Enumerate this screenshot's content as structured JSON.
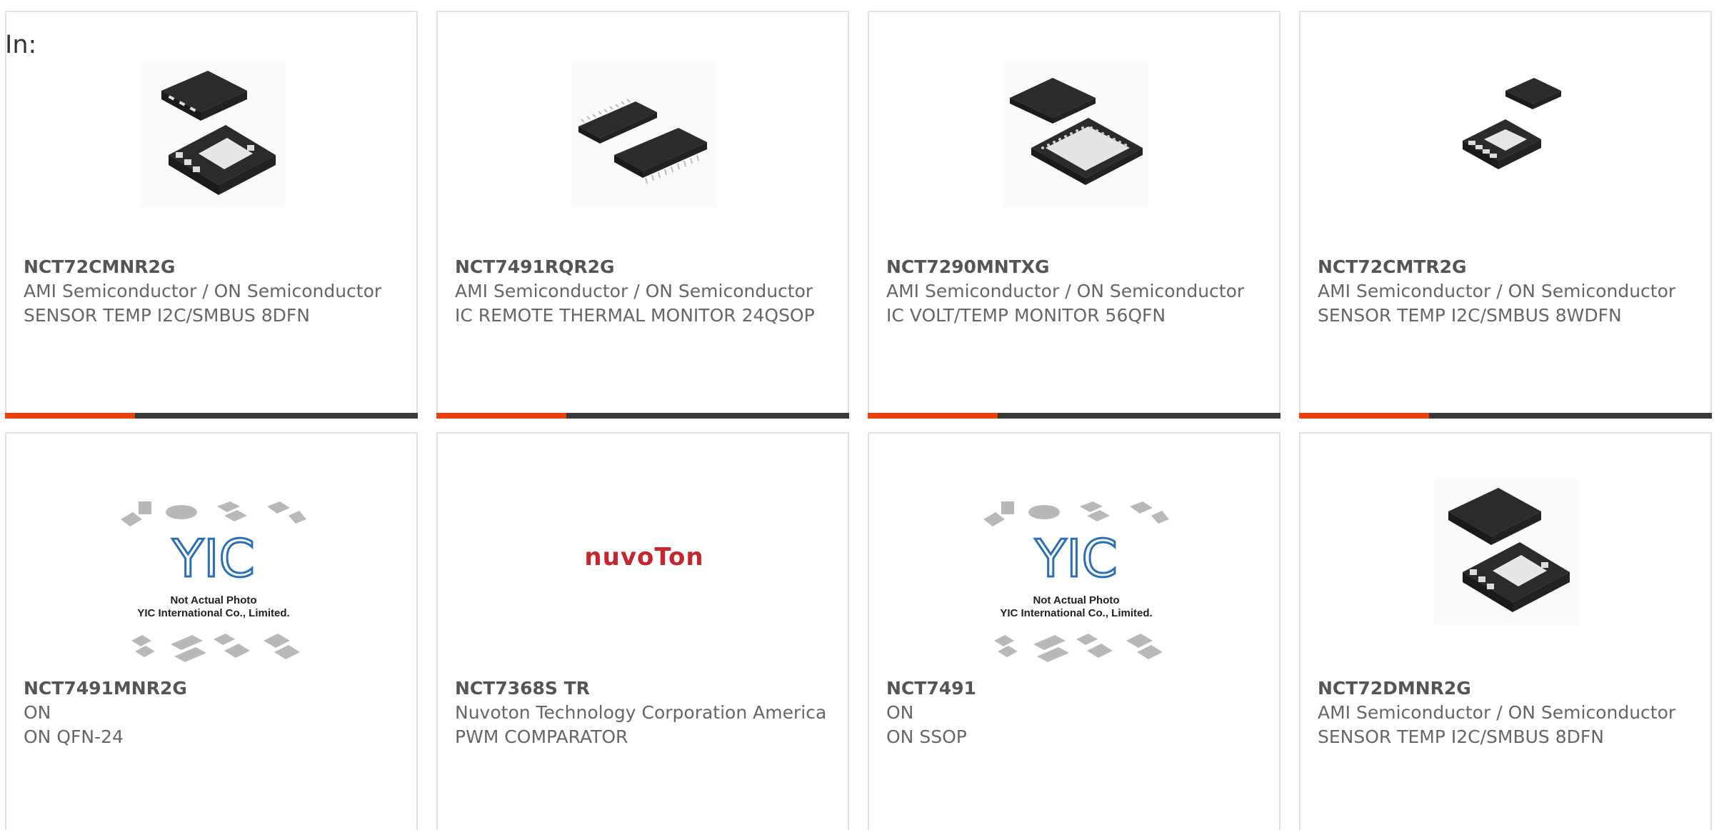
{
  "header": {
    "in_label": "In:"
  },
  "colors": {
    "accent": "#e8410f",
    "bar": "#3a3a3a",
    "card_border": "#e2e2e2",
    "text": "#666666",
    "nuvoton_red": "#c8262e",
    "yic_blue": "#2a6fb6"
  },
  "products": [
    {
      "part": "NCT72CMNR2G",
      "manufacturer": "AMI Semiconductor / ON Semiconductor",
      "description": "SENSOR TEMP I2C/SMBUS 8DFN",
      "image": "dfn-8-package-icon"
    },
    {
      "part": "NCT7491RQR2G",
      "manufacturer": "AMI Semiconductor / ON Semiconductor",
      "description": "IC REMOTE THERMAL MONITOR 24QSOP",
      "image": "qsop-24-package-icon"
    },
    {
      "part": "NCT7290MNTXG",
      "manufacturer": "AMI Semiconductor / ON Semiconductor",
      "description": "IC VOLT/TEMP MONITOR 56QFN",
      "image": "qfn-56-package-icon"
    },
    {
      "part": "NCT72CMTR2G",
      "manufacturer": "AMI Semiconductor / ON Semiconductor",
      "description": "SENSOR TEMP I2C/SMBUS 8WDFN",
      "image": "wdfn-8-package-icon"
    },
    {
      "part": "NCT7491MNR2G",
      "manufacturer": "ON",
      "description": "ON QFN-24",
      "image": "yic-placeholder-image",
      "placeholder_title": "Not Actual Photo",
      "placeholder_company": "YIC International Co., Limited."
    },
    {
      "part": "NCT7368S TR",
      "manufacturer": "Nuvoton Technology Corporation America",
      "description": "PWM COMPARATOR",
      "image": "nuvoton-logo",
      "logo_text": "nuvoTon"
    },
    {
      "part": "NCT7491",
      "manufacturer": "ON",
      "description": "ON SSOP",
      "image": "yic-placeholder-image",
      "placeholder_title": "Not Actual Photo",
      "placeholder_company": "YIC International Co., Limited."
    },
    {
      "part": "NCT72DMNR2G",
      "manufacturer": "AMI Semiconductor / ON Semiconductor",
      "description": "SENSOR TEMP I2C/SMBUS 8DFN",
      "image": "dfn-8-package-icon"
    }
  ]
}
